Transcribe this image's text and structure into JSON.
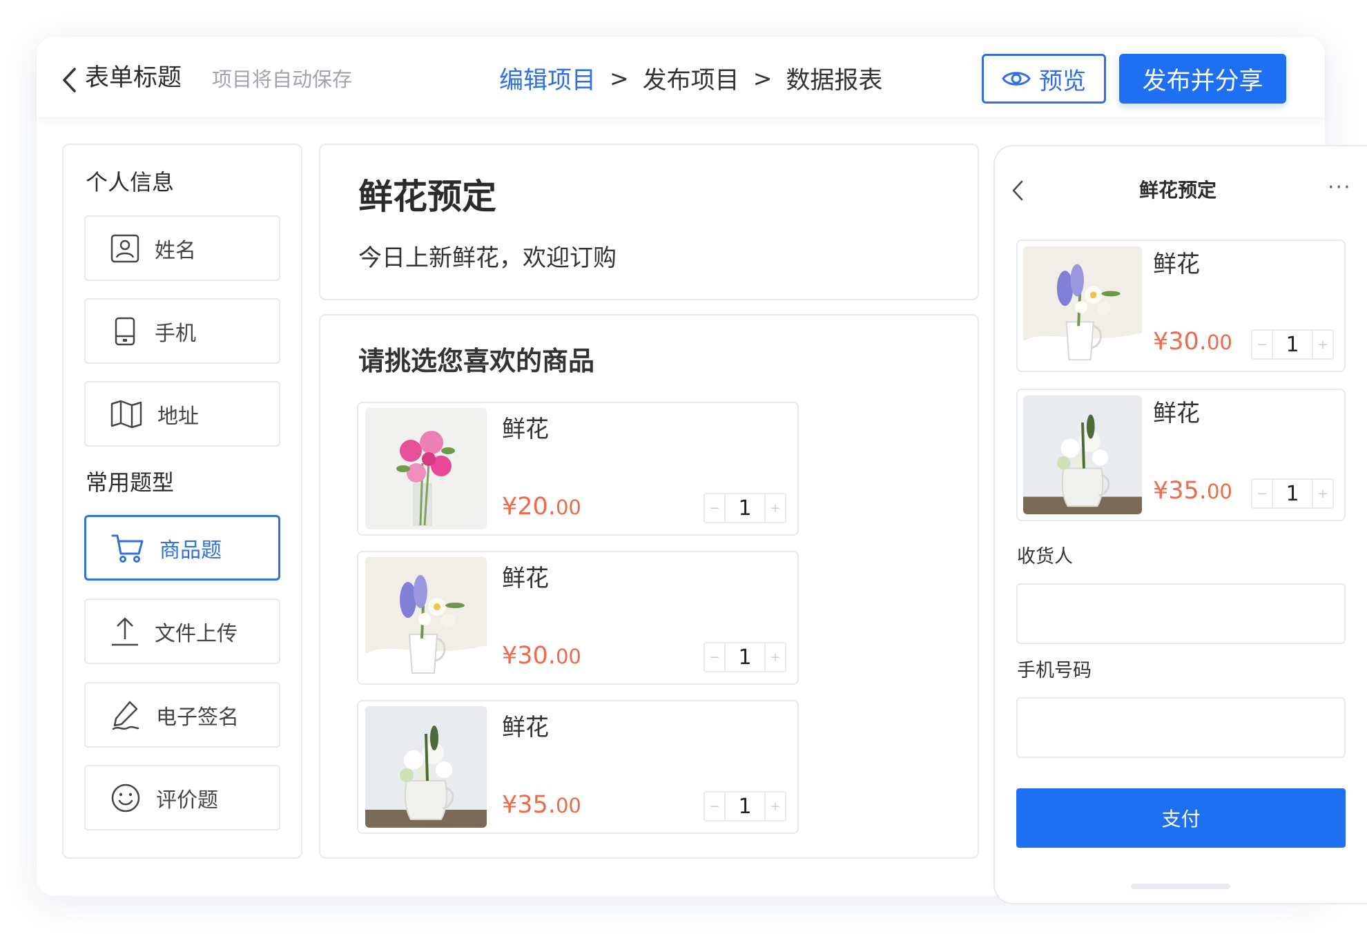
{
  "header": {
    "form_title": "表单标题",
    "autosave_text": "项目将自动保存",
    "steps": [
      {
        "label": "编辑项目",
        "active": true
      },
      {
        "label": "发布项目",
        "active": false
      },
      {
        "label": "数据报表",
        "active": false
      }
    ],
    "step_separator": ">",
    "preview_label": "预览",
    "publish_label": "发布并分享"
  },
  "sidebar": {
    "groups": [
      {
        "title": "个人信息",
        "items": [
          {
            "label": "姓名",
            "icon": "person-icon"
          },
          {
            "label": "手机",
            "icon": "phone-icon"
          },
          {
            "label": "地址",
            "icon": "map-icon"
          }
        ]
      },
      {
        "title": "常用题型",
        "items": [
          {
            "label": "商品题",
            "icon": "cart-icon",
            "selected": true
          },
          {
            "label": "文件上传",
            "icon": "upload-icon"
          },
          {
            "label": "电子签名",
            "icon": "pen-icon"
          },
          {
            "label": "评价题",
            "icon": "smile-icon"
          }
        ]
      }
    ]
  },
  "form": {
    "heading": "鲜花预定",
    "description": "今日上新鲜花，欢迎订购",
    "section_title": "请挑选您喜欢的商品",
    "products": [
      {
        "name": "鲜花",
        "price_int": "¥20.",
        "price_dec": "00",
        "qty": "1",
        "image": "pink-peony-bouquet"
      },
      {
        "name": "鲜花",
        "price_int": "¥30.",
        "price_dec": "00",
        "qty": "1",
        "image": "hyacinth-bouquet-white-jug"
      },
      {
        "name": "鲜花",
        "price_int": "¥35.",
        "price_dec": "00",
        "qty": "1",
        "image": "white-chrysanthemum-vase"
      }
    ]
  },
  "phone": {
    "title": "鲜花预定",
    "more": "···",
    "products": [
      {
        "name": "鲜花",
        "price_int": "¥30.",
        "price_dec": "00",
        "qty": "1",
        "image": "hyacinth-bouquet-white-jug"
      },
      {
        "name": "鲜花",
        "price_int": "¥35.",
        "price_dec": "00",
        "qty": "1",
        "image": "white-chrysanthemum-vase"
      }
    ],
    "receiver_label": "收货人",
    "receiver_value": "",
    "mobile_label": "手机号码",
    "mobile_value": "",
    "pay_label": "支付"
  },
  "stepper": {
    "minus": "−",
    "plus": "+"
  },
  "colors": {
    "accent": "#2f6fe0",
    "primary_button": "#1f6ff2",
    "price": "#ee6a4a",
    "border": "#e6e9ee"
  }
}
